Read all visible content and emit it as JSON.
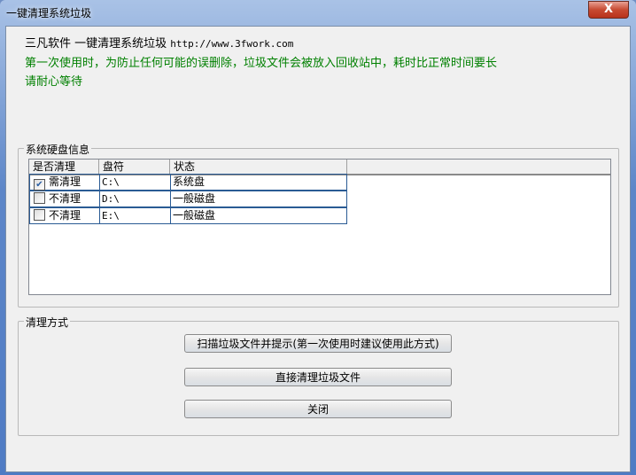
{
  "window": {
    "title": "一键清理系统垃圾",
    "close_label": "X"
  },
  "header": {
    "line1": "三凡软件 一键清理系统垃圾",
    "url": "http://www.3fwork.com",
    "notice1": "第一次使用时，为防止任何可能的误删除，垃圾文件会被放入回收站中，耗时比正常时间要长",
    "notice2": "请耐心等待"
  },
  "disk_group": {
    "label": "系统硬盘信息",
    "columns": [
      "是否清理",
      "盘符",
      "状态"
    ],
    "rows": [
      {
        "checked": true,
        "clean": "需清理",
        "drive": "C:\\",
        "status": "系统盘"
      },
      {
        "checked": false,
        "clean": "不清理",
        "drive": "D:\\",
        "status": "一般磁盘"
      },
      {
        "checked": false,
        "clean": "不清理",
        "drive": "E:\\",
        "status": "一般磁盘"
      }
    ]
  },
  "mode_group": {
    "label": "清理方式",
    "scan_button": "扫描垃圾文件并提示(第一次使用时建议使用此方式)",
    "direct_button": "直接清理垃圾文件",
    "close_button": "关闭"
  }
}
